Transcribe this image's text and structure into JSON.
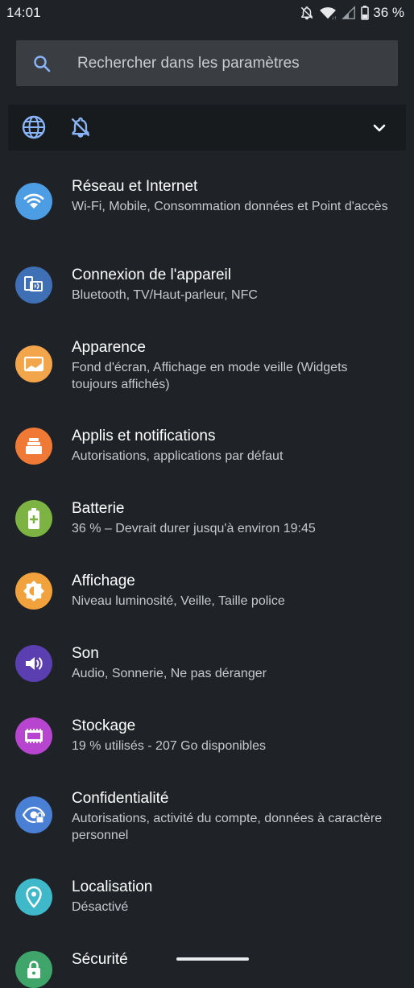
{
  "status_bar": {
    "time": "14:01",
    "battery_percent": "36 %",
    "icons": [
      "dnd-off-icon",
      "wifi-icon",
      "signal-icon",
      "battery-icon"
    ]
  },
  "search": {
    "placeholder": "Rechercher dans les paramètres"
  },
  "quick_row": {
    "icons": [
      "globe-icon",
      "dnd-off-icon",
      "expand-icon"
    ],
    "accent": "#8ab4f8"
  },
  "settings": [
    {
      "title": "Réseau et Internet",
      "subtitle": "Wi-Fi, Mobile, Consommation données et Point d'accès",
      "icon": "wifi-icon",
      "color": "#4d9de4"
    },
    {
      "title": "Connexion de l'appareil",
      "subtitle": "Bluetooth, TV/Haut-parleur, NFC",
      "icon": "device-connection-icon",
      "color": "#3f6fb4"
    },
    {
      "title": "Apparence",
      "subtitle": "Fond d'écran, Affichage en mode veille (Widgets toujours affichés)",
      "icon": "wallpaper-icon",
      "color": "#f2a54a"
    },
    {
      "title": "Applis et notifications",
      "subtitle": "Autorisations, applications par défaut",
      "icon": "apps-icon",
      "color": "#f07a35"
    },
    {
      "title": "Batterie",
      "subtitle": "36 % – Devrait durer jusqu'à environ 19:45",
      "icon": "battery-icon",
      "color": "#7cb342"
    },
    {
      "title": "Affichage",
      "subtitle": "Niveau luminosité, Veille, Taille police",
      "icon": "brightness-icon",
      "color": "#f2a23c"
    },
    {
      "title": "Son",
      "subtitle": "Audio, Sonnerie, Ne pas déranger",
      "icon": "volume-icon",
      "color": "#5b3fb0"
    },
    {
      "title": "Stockage",
      "subtitle": "19 % utilisés - 207 Go disponibles",
      "icon": "storage-icon",
      "color": "#b745cf"
    },
    {
      "title": "Confidentialité",
      "subtitle": "Autorisations, activité du compte, données à caractère personnel",
      "icon": "privacy-icon",
      "color": "#4a7fd6"
    },
    {
      "title": "Localisation",
      "subtitle": "Désactivé",
      "icon": "location-icon",
      "color": "#3fb8c9"
    },
    {
      "title": "Sécurité",
      "subtitle": "",
      "icon": "lock-icon",
      "color": "#3fa56a"
    }
  ]
}
